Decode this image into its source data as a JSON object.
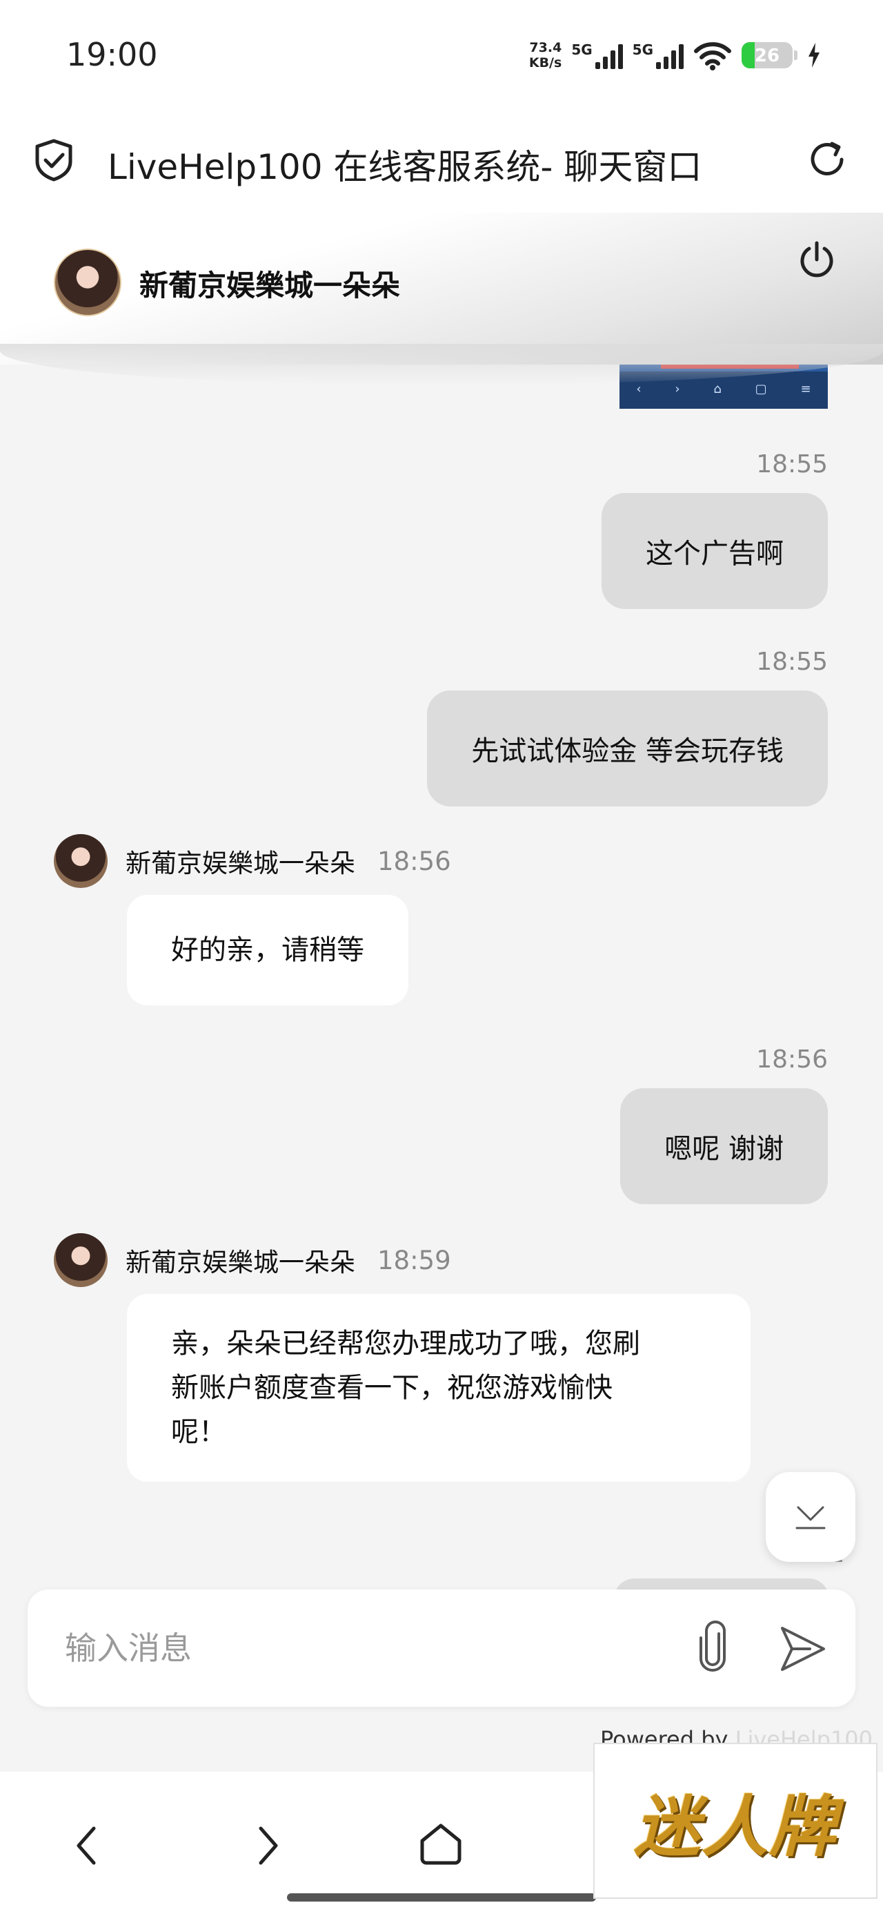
{
  "status_bar": {
    "time": "19:00",
    "speed_value": "73.4",
    "speed_unit": "KB/s",
    "network_1": "5G",
    "network_2": "5G",
    "battery": "26"
  },
  "browser": {
    "title": "LiveHelp100 在线客服系统- 聊天窗口"
  },
  "chat": {
    "agent_name": "新葡京娱樂城一朵朵",
    "messages": [
      {
        "dir": "out",
        "time": "18:55",
        "text": "这个广告啊"
      },
      {
        "dir": "out",
        "time": "18:55",
        "text": "先试试体验金 等会玩存钱"
      },
      {
        "dir": "in",
        "sender": "新葡京娱樂城一朵朵",
        "time": "18:56",
        "text": "好的亲，请稍等"
      },
      {
        "dir": "out",
        "time": "18:56",
        "text": "嗯呢 谢谢"
      },
      {
        "dir": "in",
        "sender": "新葡京娱樂城一朵朵",
        "time": "18:59",
        "text_lines": [
          "亲，朵朵已经帮您办理成功了哦，您刷",
          "新账户额度查看一下，祝您游戏愉快",
          "呢！"
        ]
      }
    ],
    "partial_time": "1"
  },
  "composer": {
    "placeholder": "输入消息"
  },
  "footer": {
    "powered_by": "Powered by",
    "brand": "LiveHelp100"
  },
  "watermark": {
    "text": "迷人牌"
  },
  "colors": {
    "bubble_out": "#dcdcdc",
    "bubble_in": "#ffffff",
    "background": "#f4f4f4",
    "battery_green": "#2ecc40"
  }
}
